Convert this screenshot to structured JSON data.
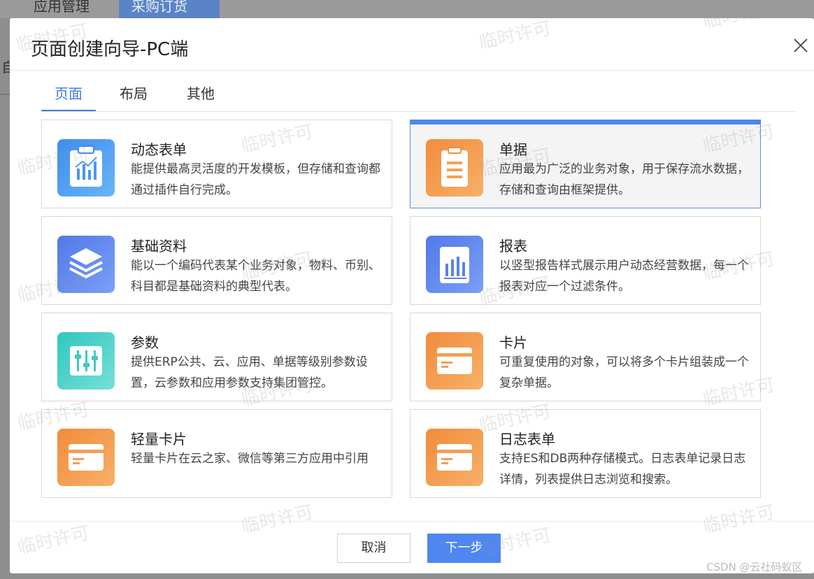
{
  "background": {
    "tabs": [
      "应用管理",
      "采购订货"
    ],
    "partial_char": "自"
  },
  "dialog": {
    "title": "页面创建向导-PC端",
    "tabs": [
      {
        "label": "页面",
        "active": true
      },
      {
        "label": "布局",
        "active": false
      },
      {
        "label": "其他",
        "active": false
      }
    ],
    "cards": [
      {
        "title": "动态表单",
        "desc": "能提供最高灵活度的开发模板，但存储和查询都通过插件自行完成。",
        "icon": "form-chart-icon",
        "selected": false
      },
      {
        "title": "单据",
        "desc": "应用最为广泛的业务对象，用于保存流水数据，存储和查询由框架提供。",
        "icon": "clipboard-icon",
        "selected": true
      },
      {
        "title": "基础资料",
        "desc": "能以一个编码代表某个业务对象，物料、币别、科目都是基础资料的典型代表。",
        "icon": "layers-icon",
        "selected": false
      },
      {
        "title": "报表",
        "desc": "以竖型报告样式展示用户动态经营数据，每一个报表对应一个过滤条件。",
        "icon": "bar-report-icon",
        "selected": false
      },
      {
        "title": "参数",
        "desc": "提供ERP公共、云、应用、单据等级别参数设置，云参数和应用参数支持集团管控。",
        "icon": "sliders-icon",
        "selected": false
      },
      {
        "title": "卡片",
        "desc": "可重复使用的对象，可以将多个卡片组装成一个复杂单据。",
        "icon": "card-icon",
        "selected": false
      },
      {
        "title": "轻量卡片",
        "desc": "轻量卡片在云之家、微信等第三方应用中引用",
        "icon": "card-icon",
        "selected": false
      },
      {
        "title": "日志表单",
        "desc": "支持ES和DB两种存储模式。日志表单记录日志详情，列表提供日志浏览和搜索。",
        "icon": "card-icon",
        "selected": false
      }
    ],
    "buttons": {
      "cancel": "取消",
      "next": "下一步"
    }
  },
  "watermark_text": "临时许可",
  "credit": "CSDN @云社码蚁区",
  "colors": {
    "primary": "#4f86f0",
    "tab_active": "#3f7be0",
    "selected_top": "#4f86e8",
    "icon_blue": "#3e8cf0",
    "icon_indigo": "#5278e8",
    "icon_teal": "#2fc7bf",
    "icon_orange": "#f18c3c"
  }
}
